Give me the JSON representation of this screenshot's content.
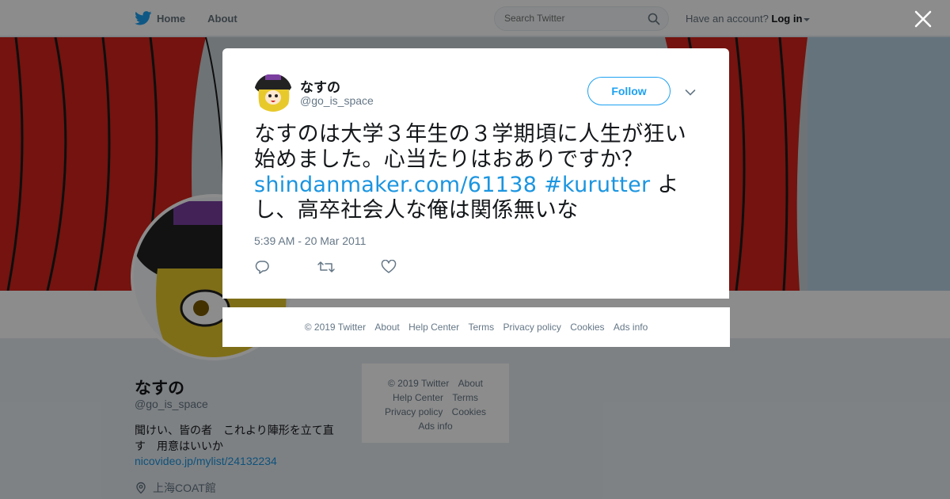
{
  "topbar": {
    "nav": [
      {
        "label": "Home",
        "icon": "twitter-bird-icon"
      },
      {
        "label": "About"
      }
    ],
    "search_placeholder": "Search Twitter",
    "account_prefix": "Have an account?",
    "login_label": "Log in"
  },
  "profile": {
    "name": "なすの",
    "handle": "@go_is_space",
    "bio": "聞けい、皆の者　これより陣形を立て直す　用意はいいか",
    "link": "nicovideo.jp/mylist/24132234",
    "location": "上海COAT館"
  },
  "side_footer": {
    "links": [
      "© 2019 Twitter",
      "About",
      "Help Center",
      "Terms",
      "Privacy policy",
      "Cookies",
      "Ads info"
    ]
  },
  "tweet": {
    "author_name": "なすの",
    "author_handle": "@go_is_space",
    "follow_label": "Follow",
    "text_part1": "なすのは大学３年生の３学期頃に人生が狂い始めました。心当たりはおありですか？",
    "link": "shindanmaker.com/61138",
    "hashtag": "#kurutter",
    "text_part2": "よし、高卒社会人な俺は関係無いな",
    "timestamp": "5:39 AM - 20 Mar 2011"
  },
  "modal_footer": {
    "links": [
      "© 2019 Twitter",
      "About",
      "Help Center",
      "Terms",
      "Privacy policy",
      "Cookies",
      "Ads info"
    ]
  },
  "colors": {
    "accent": "#1da1f2",
    "link": "#1b95e0",
    "curtain": "#d4231c",
    "overlay": "rgba(0,0,0,0.45)"
  }
}
